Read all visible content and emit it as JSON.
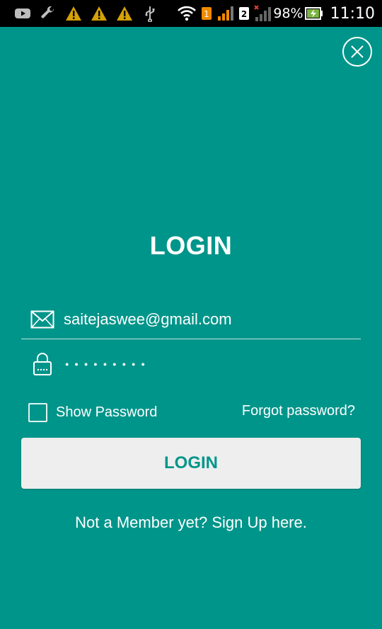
{
  "status_bar": {
    "battery": "98%",
    "time": "11:10",
    "sim1": "1",
    "sim2": "2",
    "icons": [
      "youtube-icon",
      "wrench-icon",
      "warning-icon",
      "warning-icon",
      "warning-icon",
      "usb-icon",
      "wifi-icon",
      "signal-icon",
      "signal-icon",
      "battery-charging-icon"
    ]
  },
  "login": {
    "title": "LOGIN",
    "email_value": "saitejaswee@gmail.com",
    "password_mask": "●●●●●●●●●",
    "show_password_label": "Show Password",
    "forgot_password_label": "Forgot password?",
    "login_button_label": "LOGIN",
    "signup_label": "Not a Member yet? Sign Up here."
  },
  "colors": {
    "background": "#00958a",
    "button_bg": "#eeeeee",
    "button_text": "#00958a"
  }
}
